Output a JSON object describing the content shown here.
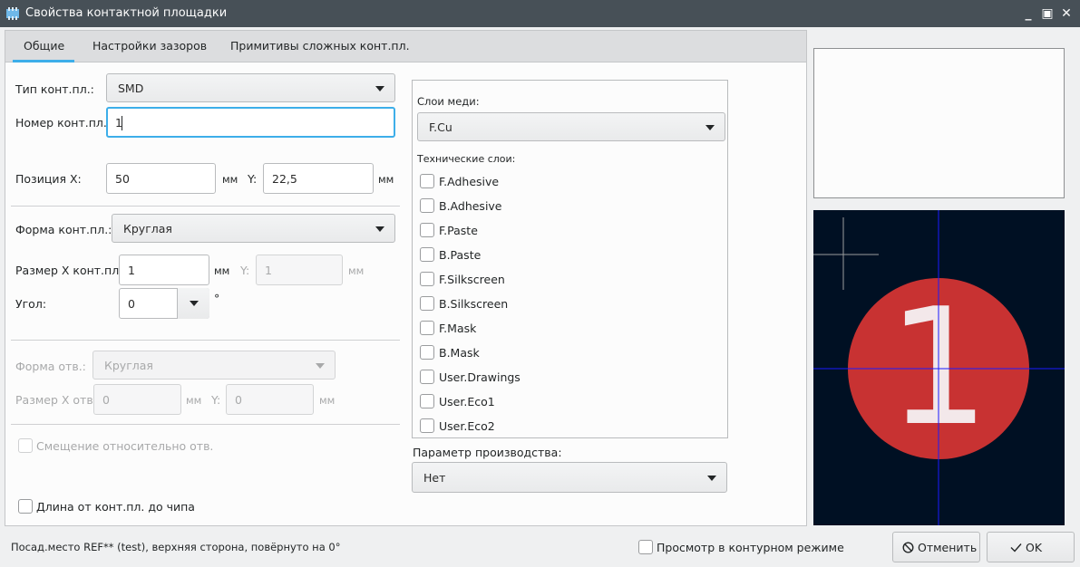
{
  "window": {
    "title": "Свойства контактной площадки",
    "controls": {
      "minimize": "_",
      "maximize": "▣",
      "close": "✕"
    }
  },
  "tabs": [
    {
      "label": "Общие",
      "active": true
    },
    {
      "label": "Настройки зазоров",
      "active": false
    },
    {
      "label": "Примитивы сложных конт.пл.",
      "active": false
    }
  ],
  "pad": {
    "type_label": "Тип конт.пл.:",
    "type_value": "SMD",
    "number_label": "Номер конт.пл.:",
    "number_value": "1",
    "pos_x_label": "Позиция X:",
    "pos_x_value": "50",
    "pos_x_unit": "мм",
    "pos_y_label": "Y:",
    "pos_y_value": "22,5",
    "pos_y_unit": "мм",
    "shape_label": "Форма конт.пл.:",
    "shape_value": "Круглая",
    "size_x_label": "Размер X конт.пл.:",
    "size_x_value": "1",
    "size_x_unit": "мм",
    "size_y_label": "Y:",
    "size_y_value": "1",
    "size_y_unit": "мм",
    "angle_label": "Угол:",
    "angle_value": "0",
    "angle_unit": "°"
  },
  "drill": {
    "shape_label": "Форма отв.:",
    "shape_value": "Круглая",
    "size_x_label": "Размер X отв.:",
    "size_x_value": "0",
    "size_x_unit": "мм",
    "size_y_label": "Y:",
    "size_y_value": "0",
    "size_y_unit": "мм",
    "offset_label": "Смещение относительно отв.",
    "offset_checked": false
  },
  "die_length": {
    "label": "Длина от конт.пл. до чипа",
    "checked": false
  },
  "layers": {
    "copper_label": "Слои меди:",
    "copper_value": "F.Cu",
    "technical_label": "Технические слои:",
    "technical": [
      {
        "name": "F.Adhesive",
        "checked": false
      },
      {
        "name": "B.Adhesive",
        "checked": false
      },
      {
        "name": "F.Paste",
        "checked": false
      },
      {
        "name": "B.Paste",
        "checked": false
      },
      {
        "name": "F.Silkscreen",
        "checked": false
      },
      {
        "name": "B.Silkscreen",
        "checked": false
      },
      {
        "name": "F.Mask",
        "checked": false
      },
      {
        "name": "B.Mask",
        "checked": false
      },
      {
        "name": "User.Drawings",
        "checked": false
      },
      {
        "name": "User.Eco1",
        "checked": false
      },
      {
        "name": "User.Eco2",
        "checked": false
      }
    ]
  },
  "fabrication": {
    "label": "Параметр производства:",
    "value": "Нет"
  },
  "preview": {
    "pad_number": "1",
    "colors": {
      "background": "#001023",
      "pad": "#c83232",
      "crosshair": "#1a1aff",
      "cursor": "#9c9c9c",
      "pad_number": "#f3e8ea"
    }
  },
  "footer": {
    "status": "Посад.место REF** (test), верхняя сторона, повёрнуто на 0°",
    "outline_label": "Просмотр в контурном режиме",
    "outline_checked": false,
    "cancel_label": "Отменить",
    "ok_label": "OK"
  }
}
